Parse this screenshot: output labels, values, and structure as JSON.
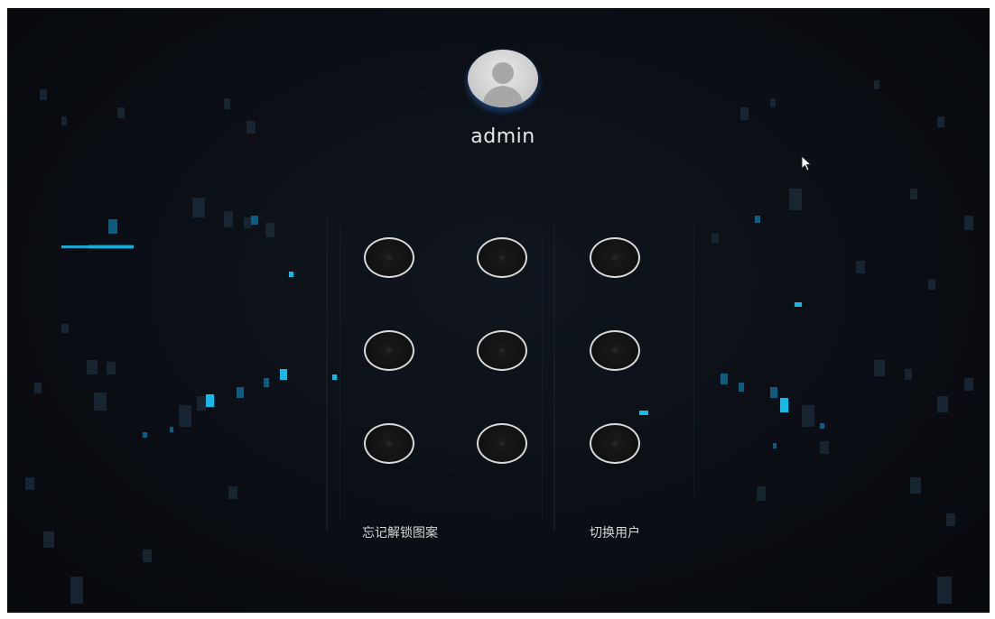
{
  "user": {
    "name": "admin",
    "avatar_icon": "user-avatar-icon"
  },
  "pattern": {
    "grid": [
      {
        "id": 1
      },
      {
        "id": 2
      },
      {
        "id": 3
      },
      {
        "id": 4
      },
      {
        "id": 5
      },
      {
        "id": 6
      },
      {
        "id": 7
      },
      {
        "id": 8
      },
      {
        "id": 9
      }
    ]
  },
  "actions": {
    "forgot_pattern": "忘记解锁图案",
    "switch_user": "切换用户"
  },
  "colors": {
    "background": "#0b0e14",
    "accent": "#19b8e6",
    "dot_border": "#d9d9d9",
    "text": "#e6e6e6"
  }
}
